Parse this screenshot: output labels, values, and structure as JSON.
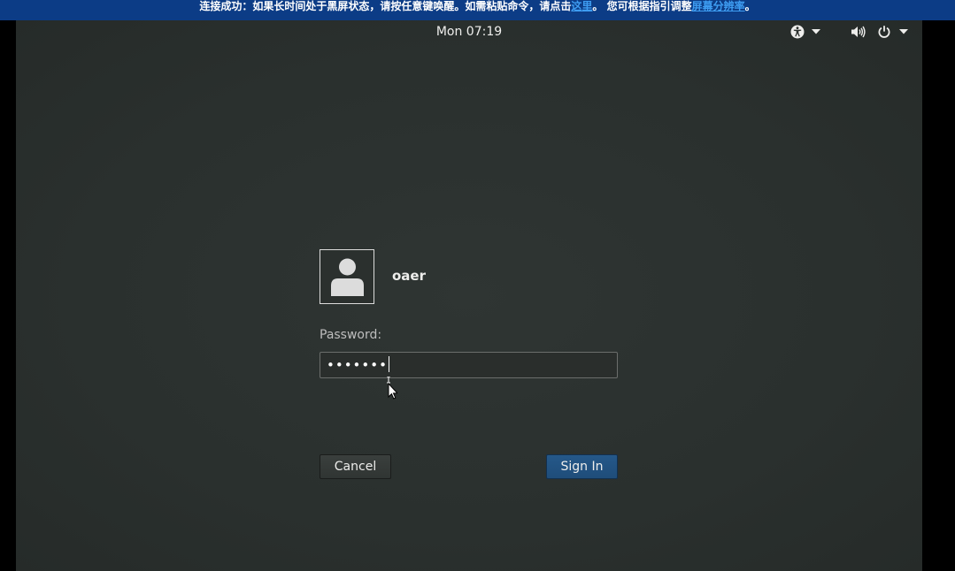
{
  "banner": {
    "text_before": "连接成功：如果长时间处于黑屏状态，请按任意键唤醒。如需粘贴命令，请点击",
    "link1": "这里",
    "text_middle": "。 您可根据指引调整",
    "link2": "屏幕分辨率",
    "text_after": "。"
  },
  "topbar": {
    "clock": "Mon 07:19",
    "icons": [
      "accessibility-icon",
      "volume-icon",
      "power-icon"
    ]
  },
  "login": {
    "username": "oaer",
    "password_label": "Password:",
    "password_value": "•••••••",
    "cancel_label": "Cancel",
    "signin_label": "Sign In"
  },
  "colors": {
    "banner_bg": "#0c3c86",
    "banner_link": "#3e9df2",
    "screen_bg": "#2b302e",
    "signin_bg": "#215180"
  }
}
